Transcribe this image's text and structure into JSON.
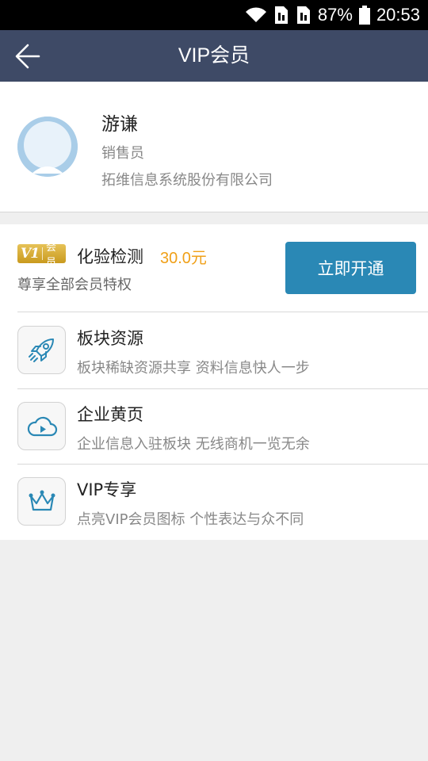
{
  "status_bar": {
    "battery": "87%",
    "time": "20:53",
    "icons": [
      "wifi-icon",
      "sim-card-icon",
      "sim-card-icon",
      "battery-icon"
    ]
  },
  "header": {
    "title": "VIP会员",
    "back_icon": "arrow-left-icon"
  },
  "profile": {
    "name": "游谦",
    "role": "销售员",
    "company": "拓维信息系统股份有限公司",
    "avatar_icon": "default-avatar-icon"
  },
  "vip": {
    "badge": {
      "level": "V1",
      "label": "会员"
    },
    "plan_name": "化验检测",
    "price": "30.0元",
    "description": "尊享全部会员特权",
    "button_label": "立即开通",
    "price_color": "#f0a018",
    "button_color": "#2a88b5"
  },
  "features": [
    {
      "icon": "rocket-icon",
      "title": "板块资源",
      "desc": "板块稀缺资源共享 资料信息快人一步"
    },
    {
      "icon": "cloud-play-icon",
      "title": "企业黄页",
      "desc": "企业信息入驻板块 无线商机一览无余"
    },
    {
      "icon": "crown-icon",
      "title": "VIP专享",
      "desc": "点亮VIP会员图标 个性表达与众不同"
    }
  ],
  "colors": {
    "title_bar": "#3e4a66",
    "icon_accent": "#2a88b5",
    "background": "#efefef"
  }
}
